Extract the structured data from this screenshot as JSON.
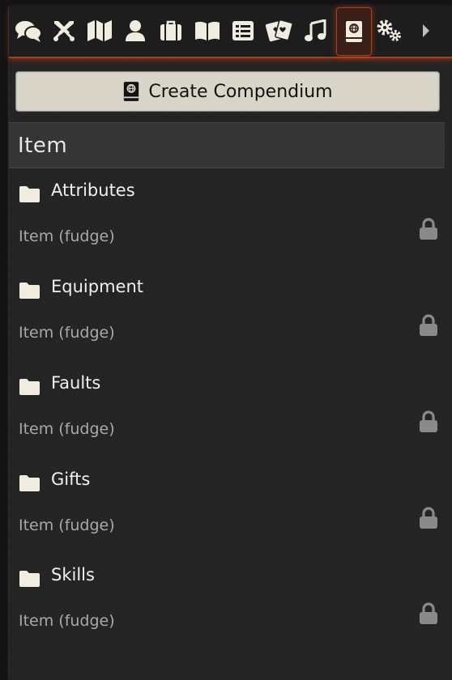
{
  "tabs": [
    {
      "name": "chat-icon",
      "title": "Chat Messages",
      "active": false
    },
    {
      "name": "combat-icon",
      "title": "Combat Encounters",
      "active": false
    },
    {
      "name": "map-icon",
      "title": "Scenes",
      "active": false
    },
    {
      "name": "user-icon",
      "title": "Actors",
      "active": false
    },
    {
      "name": "suitcase-icon",
      "title": "Items",
      "active": false
    },
    {
      "name": "book-open-icon",
      "title": "Journal Entries",
      "active": false
    },
    {
      "name": "list-icon",
      "title": "Rollable Tables",
      "active": false
    },
    {
      "name": "cards-icon",
      "title": "Card Stacks",
      "active": false
    },
    {
      "name": "music-icon",
      "title": "Audio Playlists",
      "active": false
    },
    {
      "name": "compendium-icon",
      "title": "Compendium Packs",
      "active": true
    },
    {
      "name": "gears-icon",
      "title": "Game Settings",
      "active": false
    },
    {
      "name": "caret-right-icon",
      "title": "Collapse",
      "active": false
    }
  ],
  "create_button": {
    "label": "Create Compendium",
    "icon": "compendium-icon"
  },
  "section": {
    "title": "Item"
  },
  "packs": [
    {
      "title": "Attributes",
      "subtitle": "Item (fudge)",
      "locked": true
    },
    {
      "title": "Equipment",
      "subtitle": "Item (fudge)",
      "locked": true
    },
    {
      "title": "Faults",
      "subtitle": "Item (fudge)",
      "locked": true
    },
    {
      "title": "Gifts",
      "subtitle": "Item (fudge)",
      "locked": true
    },
    {
      "title": "Skills",
      "subtitle": "Item (fudge)",
      "locked": true
    }
  ],
  "colors": {
    "accent": "#b33b1e",
    "background": "#232323",
    "button_bg": "#d9d6c9",
    "icon": "#f0ede0",
    "lock": "#8a8a8a"
  }
}
